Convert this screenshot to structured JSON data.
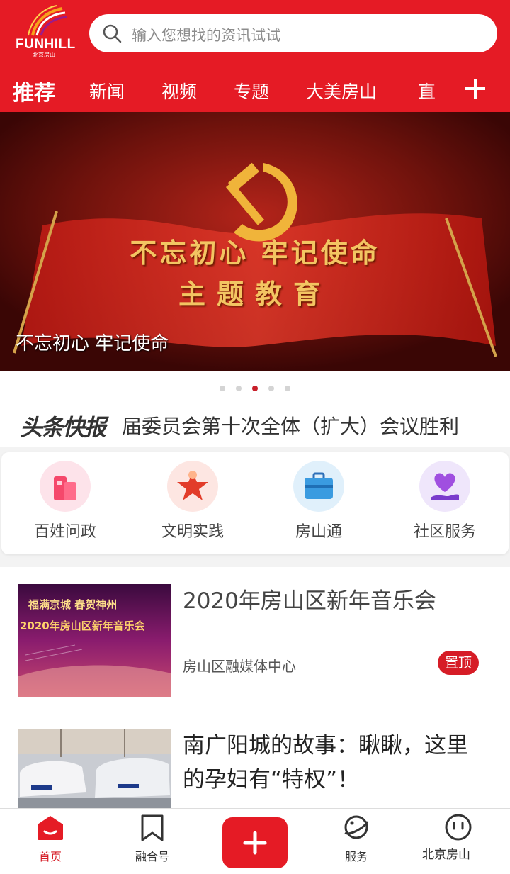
{
  "brand": {
    "logo_text": "FUNHILL",
    "logo_subtext": "北京房山"
  },
  "search": {
    "placeholder": "输入您想找的资讯试试"
  },
  "tabs": [
    {
      "label": "推荐",
      "active": true
    },
    {
      "label": "新闻"
    },
    {
      "label": "视频"
    },
    {
      "label": "专题"
    },
    {
      "label": "大美房山"
    },
    {
      "label": "直"
    }
  ],
  "banner": {
    "slogan_line1": "不忘初心 牢记使命",
    "slogan_line2": "主题教育",
    "caption": "不忘初心 牢记使命",
    "slide_count": 5,
    "active_slide": 3
  },
  "ticker": {
    "label": "头条快报",
    "text": "届委员会第十次全体（扩大）会议胜利"
  },
  "services": [
    {
      "label": "百姓问政",
      "icon": "building-icon"
    },
    {
      "label": "文明实践",
      "icon": "star-icon"
    },
    {
      "label": "房山通",
      "icon": "briefcase-icon"
    },
    {
      "label": "社区服务",
      "icon": "heart-hand-icon"
    }
  ],
  "news": [
    {
      "title": "2020年房山区新年音乐会",
      "source": "房山区融媒体中心",
      "badge": "置顶",
      "thumb_text_1": "福满京城 春贺神州",
      "thumb_text_2": "2020年房山区新年音乐会"
    },
    {
      "title": "南广阳城的故事：瞅瞅，这里的孕妇有“特权”！"
    }
  ],
  "bottom_nav": [
    {
      "label": "首页",
      "icon": "home-icon",
      "active": true
    },
    {
      "label": "融合号",
      "icon": "bookmark-icon"
    },
    {
      "label": "",
      "icon": "plus-icon"
    },
    {
      "label": "服务",
      "icon": "planet-icon"
    },
    {
      "label": "",
      "icon": "smiley-icon"
    }
  ],
  "watermark": "北京房山",
  "colors": {
    "brand_red": "#e51b25",
    "pin_red": "#d61c26",
    "gold": "#f3c562"
  }
}
